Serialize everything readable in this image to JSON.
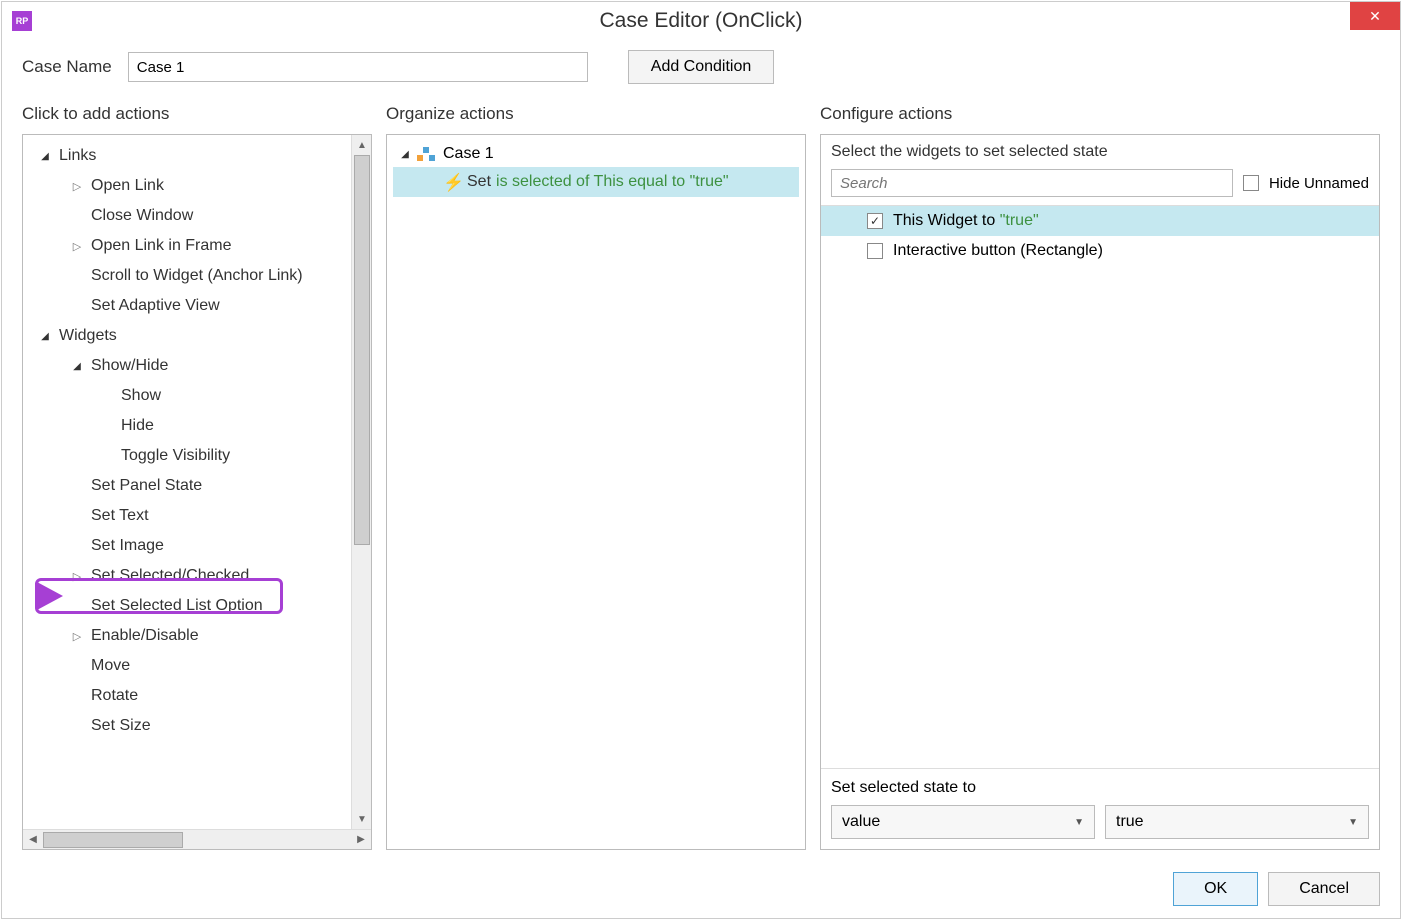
{
  "window": {
    "title": "Case Editor (OnClick)",
    "closeIcon": "✕"
  },
  "caseRow": {
    "label": "Case Name",
    "value": "Case 1",
    "addConditionBtn": "Add Condition"
  },
  "leftCol": {
    "header": "Click to add actions",
    "tree": {
      "links": "Links",
      "openLink": "Open Link",
      "closeWindow": "Close Window",
      "openLinkFrame": "Open Link in Frame",
      "scrollToWidget": "Scroll to Widget (Anchor Link)",
      "setAdaptiveView": "Set Adaptive View",
      "widgets": "Widgets",
      "showHide": "Show/Hide",
      "show": "Show",
      "hide": "Hide",
      "toggleVisibility": "Toggle Visibility",
      "setPanelState": "Set Panel State",
      "setText": "Set Text",
      "setImage": "Set Image",
      "setSelectedChecked": "Set Selected/Checked",
      "setSelectedListOption": "Set Selected List Option",
      "enableDisable": "Enable/Disable",
      "move": "Move",
      "rotate": "Rotate",
      "setSize": "Set Size"
    }
  },
  "midCol": {
    "header": "Organize actions",
    "caseLabel": "Case 1",
    "actionSet": "Set",
    "actionDesc": "is selected of This equal to \"true\""
  },
  "rightCol": {
    "header": "Configure actions",
    "selectWidgetsLabel": "Select the widgets to set selected state",
    "searchPlaceholder": "Search",
    "hideUnnamed": "Hide Unnamed",
    "items": {
      "thisWidgetPrefix": "This Widget to",
      "thisWidgetValue": "\"true\"",
      "interactiveBtn": "Interactive button (Rectangle)"
    },
    "bottomLabel": "Set selected state to",
    "dropdown1": "value",
    "dropdown2": "true"
  },
  "footer": {
    "ok": "OK",
    "cancel": "Cancel"
  }
}
